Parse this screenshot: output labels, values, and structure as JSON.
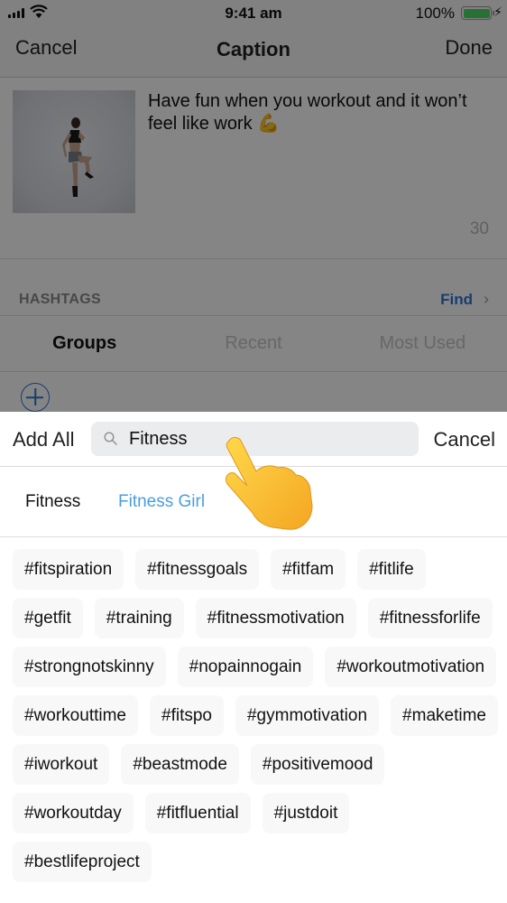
{
  "status_bar": {
    "time": "9:41 am",
    "battery_percent": "100%",
    "battery_level": 1.0,
    "battery_color": "#4cd964",
    "icons": [
      "signal-icon",
      "wifi-icon",
      "battery-icon",
      "charging-bolt-icon"
    ]
  },
  "nav": {
    "cancel_label": "Cancel",
    "title": "Caption",
    "done_label": "Done"
  },
  "post": {
    "image_alt": "Woman jumping in workout clothes",
    "caption": "Have fun when you workout and it won’t feel like work 💪",
    "char_count": "30"
  },
  "hashtags_section": {
    "label": "HASHTAGS",
    "find_label": "Find",
    "find_icon": "chevron-right-icon",
    "accent_color": "#2a77d4",
    "tabs": [
      {
        "label": "Groups",
        "active": true
      },
      {
        "label": "Recent",
        "active": false
      },
      {
        "label": "Most Used",
        "active": false
      }
    ],
    "add_icon": "plus-circle-icon"
  },
  "sheet": {
    "add_all_label": "Add All",
    "search": {
      "value": "Fitness",
      "icon": "search-icon"
    },
    "cancel_label": "Cancel",
    "groups": [
      {
        "label": "Fitness",
        "selected": false
      },
      {
        "label": "Fitness Girl",
        "selected": true
      }
    ],
    "selected_color": "#4a9ee0",
    "tags": [
      "#fitspiration",
      "#fitnessgoals",
      "#fitfam",
      "#fitlife",
      "#getfit",
      "#training",
      "#fitnessmotivation",
      "#fitnessforlife",
      "#strongnotskinny",
      "#nopainnogain",
      "#workoutmotivation",
      "#workouttime",
      "#fitspo",
      "#gymmotivation",
      "#maketime",
      "#iworkout",
      "#beastmode",
      "#positivemood",
      "#workoutday",
      "#fitfluential",
      "#justdoit",
      "#bestlifeproject"
    ]
  },
  "overlay": {
    "pointer_icon": "pointing-hand-icon"
  }
}
